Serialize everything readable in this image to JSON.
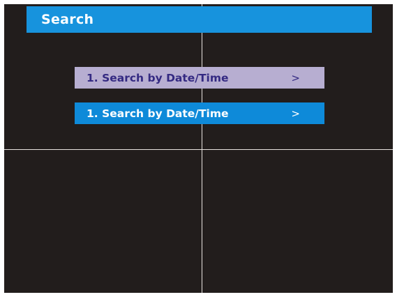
{
  "header": {
    "title": "Search"
  },
  "menu": {
    "items": [
      {
        "label": "1. Search by Date/Time",
        "arrow": ">"
      },
      {
        "label": "1. Search by Date/Time",
        "arrow": ">"
      }
    ]
  },
  "colors": {
    "background": "#221d1c",
    "accent": "#1793dd",
    "item_unselected_bg": "#b7aed1",
    "item_unselected_text": "#342a82",
    "item_selected_bg": "#0e8ad9",
    "gridline": "#e8e4e0"
  }
}
